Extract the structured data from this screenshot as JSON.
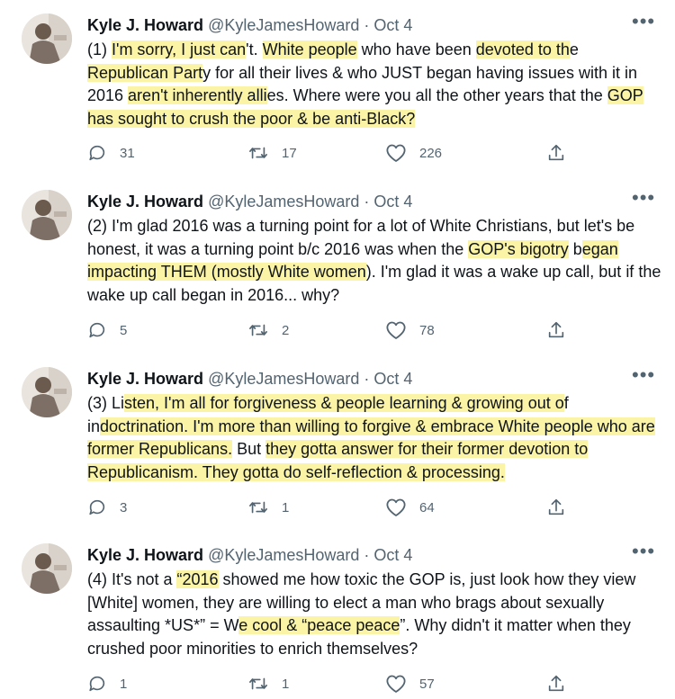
{
  "author": {
    "name": "Kyle J. Howard",
    "handle": "@KyleJamesHoward",
    "separator": "·"
  },
  "more_label": "•••",
  "tweets": [
    {
      "date": "Oct 4",
      "text_segments": [
        {
          "t": "(1) ",
          "hl": false
        },
        {
          "t": "I'm sorry, I just can",
          "hl": true
        },
        {
          "t": "'t. ",
          "hl": false
        },
        {
          "t": "White people",
          "hl": true
        },
        {
          "t": " who have been ",
          "hl": false
        },
        {
          "t": "devoted to th",
          "hl": true
        },
        {
          "t": "e ",
          "hl": false
        },
        {
          "t": "Republican Part",
          "hl": true
        },
        {
          "t": "y for all their lives & who JUST began having issues with it in 2016 ",
          "hl": false
        },
        {
          "t": "aren't inherently alli",
          "hl": true
        },
        {
          "t": "es. Where were you all the other years that the ",
          "hl": false
        },
        {
          "t": "GOP has sought to crush the poor & be anti-Black?",
          "hl": true
        }
      ],
      "replies": "31",
      "retweets": "17",
      "likes": "226"
    },
    {
      "date": "Oct 4",
      "text_segments": [
        {
          "t": "(2) I'm glad 2016 was a turning point for a lot of White Christians, but let's be honest, it was a turning point b/c 2016 was when the ",
          "hl": false
        },
        {
          "t": "GOP's bigotry",
          "hl": true
        },
        {
          "t": " b",
          "hl": false
        },
        {
          "t": "egan impacting THEM (mostly White women",
          "hl": true
        },
        {
          "t": "). I'm glad it was a wake up call, but if the wake up call began in 2016... why?",
          "hl": false
        }
      ],
      "replies": "5",
      "retweets": "2",
      "likes": "78"
    },
    {
      "date": "Oct 4",
      "text_segments": [
        {
          "t": "(3) Li",
          "hl": false
        },
        {
          "t": "sten, I'm all for forgiveness & people learning & growing out o",
          "hl": true
        },
        {
          "t": "f in",
          "hl": false
        },
        {
          "t": "doctrination. I'm more than willing to forgive & embrace White people who are former Republicans.",
          "hl": true
        },
        {
          "t": " But ",
          "hl": false
        },
        {
          "t": "they gotta answer for their former devotion to Republicanism. They gotta do self-reflection & processing.",
          "hl": true
        }
      ],
      "replies": "3",
      "retweets": "1",
      "likes": "64"
    },
    {
      "date": "Oct 4",
      "text_segments": [
        {
          "t": "(4) It's not a ",
          "hl": false
        },
        {
          "t": "“2016",
          "hl": true
        },
        {
          "t": " showed me how toxic the GOP is, just look how they view [White] women, they are willing to elect a man who brags about sexually assaulting *US*” = W",
          "hl": false
        },
        {
          "t": "e cool & “peace peace",
          "hl": true
        },
        {
          "t": "”. Why didn't it matter when they crushed poor minorities to enrich themselves?",
          "hl": false
        }
      ],
      "replies": "1",
      "retweets": "1",
      "likes": "57"
    }
  ],
  "icons": {
    "reply": "reply-icon",
    "retweet": "retweet-icon",
    "like": "heart-icon",
    "share": "share-icon",
    "more": "more-icon"
  },
  "colors": {
    "highlight": "#fbf3a5",
    "secondary_text": "#536471",
    "primary_text": "#0f1419"
  }
}
